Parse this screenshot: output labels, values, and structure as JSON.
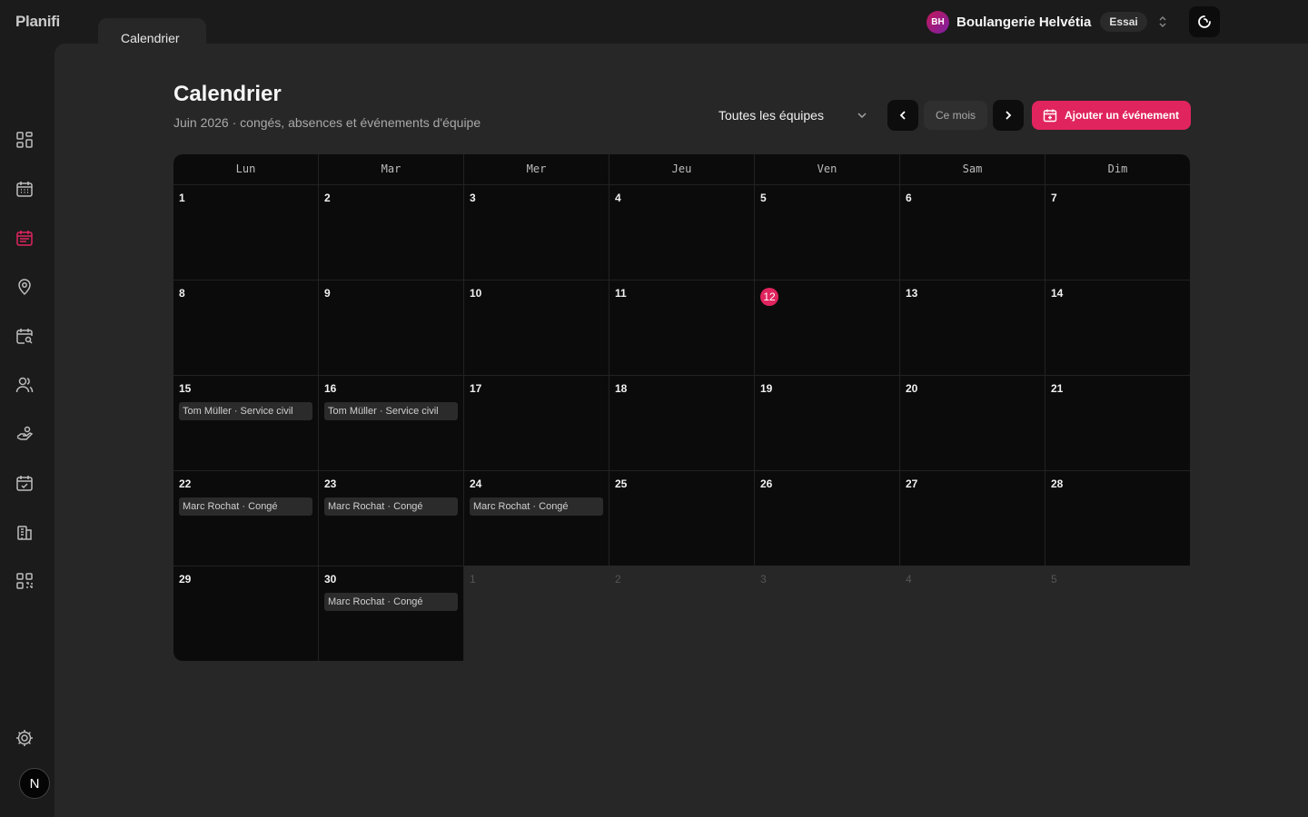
{
  "app": {
    "logo": "Planifi",
    "tab": "Calendrier"
  },
  "org": {
    "initials": "BH",
    "name": "Boulangerie Helvétia",
    "plan": "Essai"
  },
  "header": {
    "title": "Calendrier",
    "subtitle": "Juin 2026 · congés, absences et événements d'équipe",
    "team_filter": "Toutes les équipes",
    "today_label": "Ce mois",
    "add_label": "Ajouter un événement"
  },
  "sidebar": {
    "items": [
      {
        "icon": "dashboard-icon"
      },
      {
        "icon": "calendar-icon"
      },
      {
        "icon": "calendar-active-icon",
        "active": true
      },
      {
        "icon": "location-pin-icon"
      },
      {
        "icon": "calendar-search-icon"
      },
      {
        "icon": "users-icon"
      },
      {
        "icon": "hand-money-icon"
      },
      {
        "icon": "calendar-check-icon"
      },
      {
        "icon": "building-icon"
      },
      {
        "icon": "qr-code-icon"
      }
    ],
    "user_initial": "N"
  },
  "calendar": {
    "weekdays": [
      "Lun",
      "Mar",
      "Mer",
      "Jeu",
      "Ven",
      "Sam",
      "Dim"
    ],
    "weeks": [
      [
        {
          "d": "1"
        },
        {
          "d": "2"
        },
        {
          "d": "3"
        },
        {
          "d": "4"
        },
        {
          "d": "5"
        },
        {
          "d": "6"
        },
        {
          "d": "7"
        }
      ],
      [
        {
          "d": "8"
        },
        {
          "d": "9"
        },
        {
          "d": "10"
        },
        {
          "d": "11"
        },
        {
          "d": "12",
          "today": true
        },
        {
          "d": "13"
        },
        {
          "d": "14"
        }
      ],
      [
        {
          "d": "15",
          "events": [
            "Tom Müller · Service civil"
          ]
        },
        {
          "d": "16",
          "events": [
            "Tom Müller · Service civil"
          ]
        },
        {
          "d": "17"
        },
        {
          "d": "18"
        },
        {
          "d": "19"
        },
        {
          "d": "20"
        },
        {
          "d": "21"
        }
      ],
      [
        {
          "d": "22",
          "events": [
            "Marc Rochat · Congé"
          ]
        },
        {
          "d": "23",
          "events": [
            "Marc Rochat · Congé"
          ]
        },
        {
          "d": "24",
          "events": [
            "Marc Rochat · Congé"
          ]
        },
        {
          "d": "25"
        },
        {
          "d": "26"
        },
        {
          "d": "27"
        },
        {
          "d": "28"
        }
      ],
      [
        {
          "d": "29"
        },
        {
          "d": "30",
          "events": [
            "Marc Rochat · Congé"
          ]
        },
        {
          "d": "1",
          "out": true
        },
        {
          "d": "2",
          "out": true
        },
        {
          "d": "3",
          "out": true
        },
        {
          "d": "4",
          "out": true
        },
        {
          "d": "5",
          "out": true
        }
      ]
    ]
  },
  "colors": {
    "accent": "#e0245e",
    "bg": "#1b1b1b",
    "panel": "#272727",
    "cell": "#0b0b0b"
  }
}
